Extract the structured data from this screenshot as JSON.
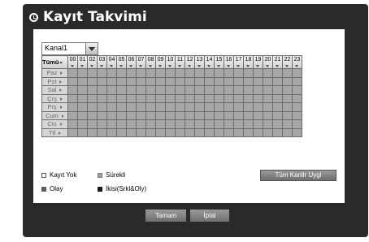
{
  "window": {
    "title": "Kayıt Takvimi"
  },
  "channel": {
    "selected": "Kanal1"
  },
  "grid": {
    "corner_label": "Tümü",
    "hours": [
      "00",
      "01",
      "02",
      "03",
      "04",
      "05",
      "06",
      "07",
      "08",
      "09",
      "10",
      "11",
      "12",
      "13",
      "14",
      "15",
      "16",
      "17",
      "18",
      "19",
      "20",
      "21",
      "22",
      "23"
    ],
    "days": [
      "Paz",
      "Pzt",
      "Sal",
      "Çrş",
      "Prş",
      "Cum",
      "Cts",
      "Ttl"
    ]
  },
  "legend": {
    "no_record": "Kayıt Yok",
    "continuous": "Sürekli",
    "event": "Olay",
    "both": "İkisi(Srkl&Oly)"
  },
  "buttons": {
    "apply_all": "Tüm Kanllr Uygl",
    "ok": "Tamam",
    "cancel": "İptal"
  },
  "colors": {
    "no_record": "#ffffff",
    "continuous": "#a6a6a6",
    "event": "#5e5e5e",
    "both": "#1a1a1a"
  }
}
